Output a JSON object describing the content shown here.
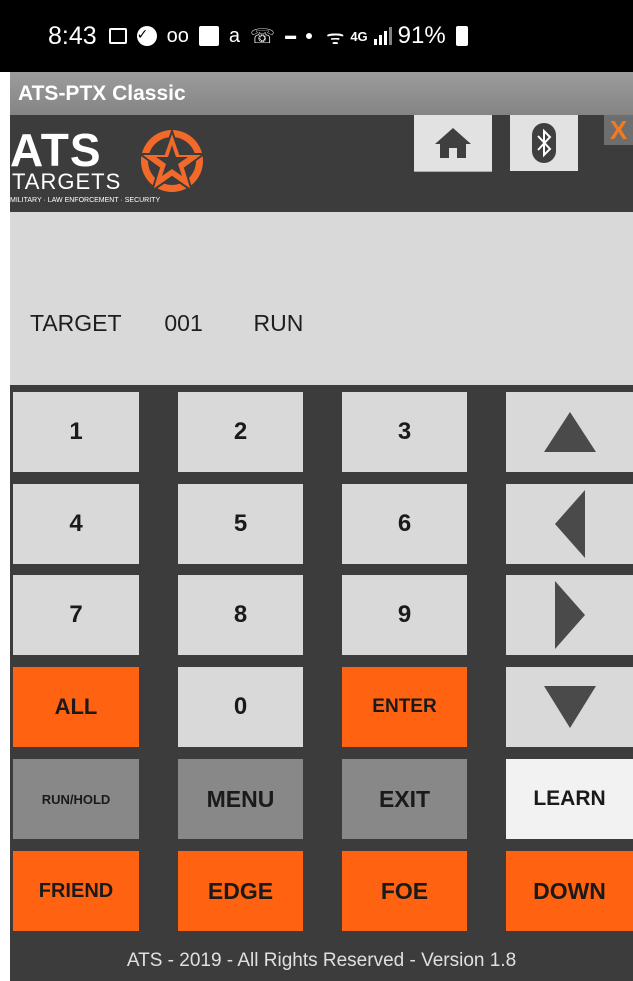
{
  "status_bar": {
    "time": "8:43",
    "network": "4G",
    "battery": "91%"
  },
  "app": {
    "title": "ATS-PTX Classic"
  },
  "logo": {
    "brand": "ATS",
    "word": "TARGETS",
    "tagline": "MILITARY · LAW ENFORCEMENT · SECURITY",
    "accent_color": "#f26a2a"
  },
  "header": {
    "close_label": "X"
  },
  "display": {
    "label": "TARGET",
    "target_number": "001",
    "mode": "RUN"
  },
  "keypad": {
    "k1": "1",
    "k2": "2",
    "k3": "3",
    "k4": "4",
    "k5": "5",
    "k6": "6",
    "k7": "7",
    "k8": "8",
    "k9": "9",
    "all": "ALL",
    "k0": "0",
    "enter": "ENTER",
    "run_hold": "RUN/HOLD",
    "menu": "MENU",
    "exit": "EXIT",
    "learn": "LEARN",
    "friend": "FRIEND",
    "edge": "EDGE",
    "foe": "FOE",
    "down": "DOWN"
  },
  "colors": {
    "orange": "#ff6210",
    "panel": "#3c3c3c",
    "key_light": "#d9d9d9",
    "key_dark": "#888888"
  },
  "footer": {
    "text": "ATS - 2019 - All Rights Reserved - Version 1.8"
  }
}
